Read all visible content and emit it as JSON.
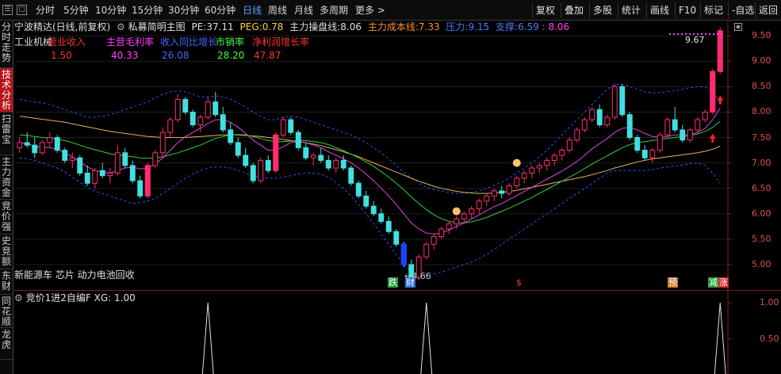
{
  "toolbar": {
    "periods": [
      "分时",
      "5分钟",
      "10分钟",
      "15分钟",
      "30分钟",
      "60分钟",
      "日线",
      "周线",
      "月线",
      "多周期",
      "更多 >"
    ],
    "active_period": "日线",
    "right_buttons": [
      "复权",
      "叠加",
      "多股",
      "统计",
      "画线",
      "F10",
      "标记",
      "-自选",
      "返回"
    ]
  },
  "left_tabs": [
    {
      "label": "分时走势",
      "active": false
    },
    {
      "label": "技术分析",
      "active": true
    },
    {
      "label": "扫雷宝",
      "active": false
    },
    {
      "label": "主力资金",
      "active": false
    },
    {
      "label": "竞价强",
      "active": false
    },
    {
      "label": "史竞额",
      "active": false
    },
    {
      "label": "东财",
      "active": false
    },
    {
      "label": "同花顺",
      "active": false
    },
    {
      "label": "龙虎",
      "active": false
    }
  ],
  "header": {
    "stock": "宁波精达(日线,前复权)",
    "indicator": "私募简明主图",
    "pe_label": "PE:",
    "pe_value": "37.11",
    "peg_label": "PEG:",
    "peg_value": "0.78",
    "ctrl_label": "主力操盘线:",
    "ctrl_value": "8.06",
    "cost_label": "主力成本线:",
    "cost_value": "7.33",
    "press_label": "压力:",
    "press_value": "9.15",
    "support_label": "支撑:",
    "support_value": "6.59",
    "extra_value": ": 8.06"
  },
  "fundamentals": {
    "industry": "工业机械",
    "items": [
      {
        "label": "营业收入",
        "value": "1.50",
        "color": "#ff3030"
      },
      {
        "label": "主营毛利率",
        "value": "40.33",
        "color": "#ff40ff"
      },
      {
        "label": "收入同比增长",
        "value": "26.08",
        "color": "#4466ff"
      },
      {
        "label": "市销率",
        "value": "28.20",
        "color": "#40ff40"
      },
      {
        "label": "净利润增长率",
        "value": "47.87",
        "color": "#ff3030"
      }
    ]
  },
  "concepts": "新能源车 芯片 动力电池回收",
  "annotations": {
    "low_label": "←4.66",
    "high_label": "9.67",
    "markers": [
      {
        "text": "跌",
        "bg": "#1f9e3a"
      },
      {
        "text": "财",
        "bg": "#2f6fd6"
      },
      {
        "text": "$",
        "bg": "none",
        "color": "#ff3030"
      },
      {
        "text": "预",
        "bg": "#c87a2a"
      },
      {
        "text": "减",
        "bg": "#1f9e3a"
      },
      {
        "text": "涨",
        "bg": "#d62020"
      }
    ]
  },
  "price_axis": [
    "9.50",
    "9.00",
    "8.50",
    "8.00",
    "7.50",
    "7.00",
    "6.50",
    "6.00",
    "5.50",
    "5.00"
  ],
  "sub_indicator": {
    "title": "竞价1进2自编F",
    "xg_label": "XG:",
    "xg_value": "1.00",
    "axis": [
      "1.00",
      "0.50"
    ]
  },
  "colors": {
    "up": "#ff2d6f",
    "down": "#40e0e0",
    "accent": "#4aa8ff",
    "ma_short": "#e040e0",
    "ma_mid": "#30d030",
    "ma_long": "#e8b060",
    "band": "#3050ff"
  },
  "chart_data": {
    "type": "candlestick",
    "ylim": [
      4.5,
      9.8
    ],
    "candles": [
      [
        7.3,
        7.5,
        7.2,
        7.4
      ],
      [
        7.4,
        7.6,
        7.3,
        7.35
      ],
      [
        7.35,
        7.5,
        7.1,
        7.2
      ],
      [
        7.2,
        7.45,
        7.15,
        7.4
      ],
      [
        7.4,
        7.6,
        7.3,
        7.5
      ],
      [
        7.5,
        7.55,
        7.2,
        7.25
      ],
      [
        7.25,
        7.3,
        7.0,
        7.05
      ],
      [
        7.05,
        7.2,
        6.9,
        7.1
      ],
      [
        7.1,
        7.15,
        6.75,
        6.8
      ],
      [
        6.8,
        6.95,
        6.55,
        6.6
      ],
      [
        6.6,
        6.9,
        6.5,
        6.85
      ],
      [
        6.85,
        7.0,
        6.7,
        6.75
      ],
      [
        6.75,
        6.9,
        6.6,
        6.8
      ],
      [
        6.8,
        7.35,
        6.75,
        7.2
      ],
      [
        7.2,
        7.3,
        6.9,
        6.95
      ],
      [
        6.95,
        7.05,
        6.6,
        6.65
      ],
      [
        6.65,
        6.75,
        6.3,
        6.35
      ],
      [
        6.35,
        7.0,
        6.3,
        6.95
      ],
      [
        6.95,
        7.25,
        6.9,
        7.2
      ],
      [
        7.2,
        7.7,
        7.1,
        7.6
      ],
      [
        7.6,
        7.9,
        7.5,
        7.85
      ],
      [
        7.85,
        8.35,
        7.8,
        8.25
      ],
      [
        8.25,
        8.3,
        7.95,
        8.0
      ],
      [
        8.0,
        8.05,
        7.7,
        7.75
      ],
      [
        7.75,
        7.95,
        7.6,
        7.9
      ],
      [
        7.9,
        8.3,
        7.85,
        8.2
      ],
      [
        8.2,
        8.4,
        7.9,
        7.95
      ],
      [
        7.95,
        8.1,
        7.6,
        7.65
      ],
      [
        7.65,
        7.8,
        7.35,
        7.4
      ],
      [
        7.4,
        7.5,
        7.1,
        7.15
      ],
      [
        7.15,
        7.3,
        6.9,
        6.95
      ],
      [
        6.95,
        7.0,
        6.6,
        6.65
      ],
      [
        6.65,
        7.1,
        6.6,
        7.05
      ],
      [
        7.05,
        7.15,
        6.8,
        6.85
      ],
      [
        6.85,
        7.6,
        6.8,
        7.55
      ],
      [
        7.55,
        7.9,
        7.5,
        7.85
      ],
      [
        7.85,
        7.9,
        7.55,
        7.6
      ],
      [
        7.6,
        7.65,
        7.25,
        7.3
      ],
      [
        7.3,
        7.4,
        7.05,
        7.1
      ],
      [
        7.1,
        7.2,
        6.95,
        7.15
      ],
      [
        7.15,
        7.3,
        7.0,
        7.05
      ],
      [
        7.05,
        7.15,
        6.85,
        6.9
      ],
      [
        6.9,
        7.1,
        6.8,
        7.05
      ],
      [
        7.05,
        7.15,
        6.85,
        6.9
      ],
      [
        6.9,
        6.95,
        6.55,
        6.6
      ],
      [
        6.6,
        6.65,
        6.3,
        6.35
      ],
      [
        6.35,
        6.45,
        6.1,
        6.15
      ],
      [
        6.15,
        6.25,
        5.95,
        6.0
      ],
      [
        6.0,
        6.1,
        5.8,
        5.85
      ],
      [
        5.85,
        5.95,
        5.6,
        5.65
      ],
      [
        5.65,
        5.7,
        5.35,
        5.4
      ],
      [
        5.4,
        5.45,
        4.95,
        5.0
      ],
      [
        5.0,
        5.1,
        4.66,
        4.75
      ],
      [
        4.75,
        5.2,
        4.7,
        5.15
      ],
      [
        5.15,
        5.45,
        5.1,
        5.4
      ],
      [
        5.4,
        5.6,
        5.3,
        5.55
      ],
      [
        5.55,
        5.75,
        5.5,
        5.7
      ],
      [
        5.7,
        5.85,
        5.6,
        5.8
      ],
      [
        5.8,
        5.95,
        5.7,
        5.9
      ],
      [
        5.9,
        6.05,
        5.8,
        6.0
      ],
      [
        6.0,
        6.15,
        5.9,
        6.1
      ],
      [
        6.1,
        6.3,
        6.0,
        6.25
      ],
      [
        6.25,
        6.4,
        6.15,
        6.35
      ],
      [
        6.35,
        6.5,
        6.25,
        6.45
      ],
      [
        6.45,
        6.55,
        6.3,
        6.4
      ],
      [
        6.4,
        6.6,
        6.35,
        6.55
      ],
      [
        6.55,
        6.75,
        6.5,
        6.7
      ],
      [
        6.7,
        6.85,
        6.6,
        6.8
      ],
      [
        6.8,
        6.95,
        6.7,
        6.9
      ],
      [
        6.9,
        7.0,
        6.8,
        6.95
      ],
      [
        6.95,
        7.1,
        6.85,
        7.05
      ],
      [
        7.05,
        7.2,
        6.95,
        7.15
      ],
      [
        7.15,
        7.3,
        7.05,
        7.25
      ],
      [
        7.25,
        7.5,
        7.2,
        7.45
      ],
      [
        7.45,
        7.7,
        7.4,
        7.65
      ],
      [
        7.65,
        7.9,
        7.6,
        7.85
      ],
      [
        7.85,
        8.1,
        7.8,
        8.05
      ],
      [
        8.05,
        8.15,
        7.7,
        7.75
      ],
      [
        7.75,
        7.95,
        7.7,
        7.9
      ],
      [
        7.9,
        8.55,
        7.85,
        8.5
      ],
      [
        8.5,
        8.55,
        7.9,
        7.95
      ],
      [
        7.95,
        8.0,
        7.45,
        7.5
      ],
      [
        7.5,
        7.55,
        7.2,
        7.25
      ],
      [
        7.25,
        7.35,
        7.05,
        7.1
      ],
      [
        7.1,
        7.3,
        7.0,
        7.25
      ],
      [
        7.25,
        7.6,
        7.2,
        7.55
      ],
      [
        7.55,
        7.9,
        7.5,
        7.85
      ],
      [
        7.85,
        8.1,
        7.6,
        7.65
      ],
      [
        7.65,
        7.75,
        7.4,
        7.45
      ],
      [
        7.45,
        7.7,
        7.4,
        7.65
      ],
      [
        7.65,
        7.9,
        7.6,
        7.85
      ],
      [
        7.85,
        8.05,
        7.8,
        8.0
      ],
      [
        8.0,
        8.85,
        7.95,
        8.8
      ],
      [
        8.8,
        9.67,
        8.75,
        9.6
      ]
    ],
    "ma_short": [
      7.4,
      7.38,
      7.33,
      7.3,
      7.3,
      7.27,
      7.2,
      7.12,
      7.02,
      6.92,
      6.85,
      6.82,
      6.8,
      6.85,
      6.9,
      6.92,
      6.88,
      6.9,
      6.98,
      7.1,
      7.25,
      7.4,
      7.52,
      7.6,
      7.68,
      7.78,
      7.85,
      7.85,
      7.8,
      7.7,
      7.58,
      7.45,
      7.35,
      7.25,
      7.25,
      7.32,
      7.4,
      7.42,
      7.4,
      7.35,
      7.3,
      7.22,
      7.15,
      7.08,
      7.0,
      6.9,
      6.78,
      6.65,
      6.5,
      6.35,
      6.18,
      6.0,
      5.82,
      5.7,
      5.62,
      5.6,
      5.62,
      5.68,
      5.75,
      5.82,
      5.9,
      5.98,
      6.06,
      6.14,
      6.2,
      6.28,
      6.36,
      6.44,
      6.52,
      6.6,
      6.68,
      6.76,
      6.84,
      6.93,
      7.03,
      7.15,
      7.28,
      7.38,
      7.48,
      7.6,
      7.68,
      7.7,
      7.65,
      7.58,
      7.52,
      7.5,
      7.52,
      7.55,
      7.55,
      7.56,
      7.6,
      7.68,
      7.85,
      8.08
    ],
    "ma_mid": [
      7.55,
      7.54,
      7.52,
      7.5,
      7.49,
      7.47,
      7.44,
      7.4,
      7.35,
      7.3,
      7.26,
      7.22,
      7.18,
      7.16,
      7.14,
      7.12,
      7.1,
      7.09,
      7.1,
      7.12,
      7.16,
      7.2,
      7.25,
      7.3,
      7.35,
      7.42,
      7.48,
      7.52,
      7.55,
      7.56,
      7.55,
      7.52,
      7.48,
      7.44,
      7.42,
      7.42,
      7.43,
      7.44,
      7.44,
      7.42,
      7.4,
      7.36,
      7.3,
      7.24,
      7.17,
      7.1,
      7.02,
      6.93,
      6.83,
      6.72,
      6.6,
      6.47,
      6.33,
      6.2,
      6.08,
      5.98,
      5.9,
      5.85,
      5.82,
      5.82,
      5.84,
      5.88,
      5.93,
      5.99,
      6.05,
      6.11,
      6.18,
      6.25,
      6.32,
      6.4,
      6.48,
      6.56,
      6.64,
      6.72,
      6.8,
      6.89,
      6.98,
      7.06,
      7.14,
      7.22,
      7.3,
      7.36,
      7.4,
      7.42,
      7.44,
      7.46,
      7.48,
      7.5,
      7.52,
      7.54,
      7.57,
      7.62,
      7.7,
      7.82
    ],
    "ma_long": [
      7.92,
      7.9,
      7.88,
      7.86,
      7.84,
      7.82,
      7.8,
      7.77,
      7.74,
      7.71,
      7.68,
      7.65,
      7.62,
      7.6,
      7.58,
      7.56,
      7.54,
      7.52,
      7.51,
      7.5,
      7.5,
      7.5,
      7.5,
      7.51,
      7.52,
      7.53,
      7.54,
      7.55,
      7.55,
      7.55,
      7.54,
      7.53,
      7.52,
      7.5,
      7.48,
      7.46,
      7.44,
      7.42,
      7.4,
      7.37,
      7.34,
      7.3,
      7.26,
      7.22,
      7.17,
      7.12,
      7.06,
      7.0,
      6.94,
      6.88,
      6.82,
      6.76,
      6.7,
      6.64,
      6.59,
      6.54,
      6.5,
      6.47,
      6.44,
      6.42,
      6.41,
      6.4,
      6.4,
      6.41,
      6.42,
      6.44,
      6.46,
      6.49,
      6.52,
      6.55,
      6.58,
      6.61,
      6.64,
      6.67,
      6.7,
      6.73,
      6.77,
      6.81,
      6.85,
      6.9,
      6.94,
      6.98,
      7.02,
      7.05,
      7.08,
      7.1,
      7.12,
      7.14,
      7.16,
      7.18,
      7.2,
      7.23,
      7.27,
      7.33
    ],
    "band_upper": [
      8.25,
      8.22,
      8.2,
      8.18,
      8.15,
      8.1,
      8.05,
      8.0,
      7.95,
      7.9,
      7.9,
      7.92,
      7.95,
      8.0,
      8.05,
      8.1,
      8.15,
      8.2,
      8.28,
      8.35,
      8.4,
      8.42,
      8.4,
      8.35,
      8.3,
      8.3,
      8.32,
      8.3,
      8.25,
      8.18,
      8.1,
      8.0,
      7.92,
      7.85,
      7.85,
      7.9,
      7.92,
      7.9,
      7.85,
      7.8,
      7.75,
      7.7,
      7.65,
      7.6,
      7.55,
      7.48,
      7.4,
      7.3,
      7.2,
      7.08,
      6.95,
      6.82,
      6.7,
      6.6,
      6.52,
      6.48,
      6.45,
      6.42,
      6.4,
      6.4,
      6.42,
      6.45,
      6.5,
      6.56,
      6.62,
      6.7,
      6.8,
      6.9,
      7.0,
      7.12,
      7.25,
      7.4,
      7.55,
      7.7,
      7.85,
      8.0,
      8.15,
      8.3,
      8.45,
      8.55,
      8.55,
      8.5,
      8.45,
      8.4,
      8.38,
      8.38,
      8.4,
      8.42,
      8.45,
      8.48,
      8.5,
      8.5,
      8.4,
      8.2
    ],
    "band_lower": [
      7.1,
      7.08,
      7.05,
      7.0,
      6.95,
      6.9,
      6.82,
      6.72,
      6.62,
      6.52,
      6.45,
      6.4,
      6.35,
      6.3,
      6.25,
      6.2,
      6.22,
      6.25,
      6.3,
      6.4,
      6.5,
      6.6,
      6.7,
      6.78,
      6.85,
      6.9,
      6.92,
      6.92,
      6.9,
      6.85,
      6.8,
      6.75,
      6.72,
      6.7,
      6.7,
      6.72,
      6.75,
      6.78,
      6.8,
      6.8,
      6.78,
      6.72,
      6.62,
      6.5,
      6.35,
      6.18,
      6.0,
      5.8,
      5.6,
      5.4,
      5.2,
      5.0,
      4.85,
      4.8,
      4.8,
      4.82,
      4.85,
      4.9,
      4.95,
      5.0,
      5.05,
      5.12,
      5.2,
      5.3,
      5.4,
      5.5,
      5.6,
      5.7,
      5.8,
      5.9,
      6.0,
      6.1,
      6.2,
      6.3,
      6.4,
      6.5,
      6.6,
      6.7,
      6.8,
      6.85,
      6.85,
      6.85,
      6.85,
      6.85,
      6.87,
      6.9,
      6.92,
      6.94,
      6.96,
      6.98,
      7.0,
      6.95,
      6.8,
      6.6
    ],
    "sub_ylim": [
      0,
      1.1
    ],
    "xg_signals": [
      25,
      54,
      93
    ]
  }
}
